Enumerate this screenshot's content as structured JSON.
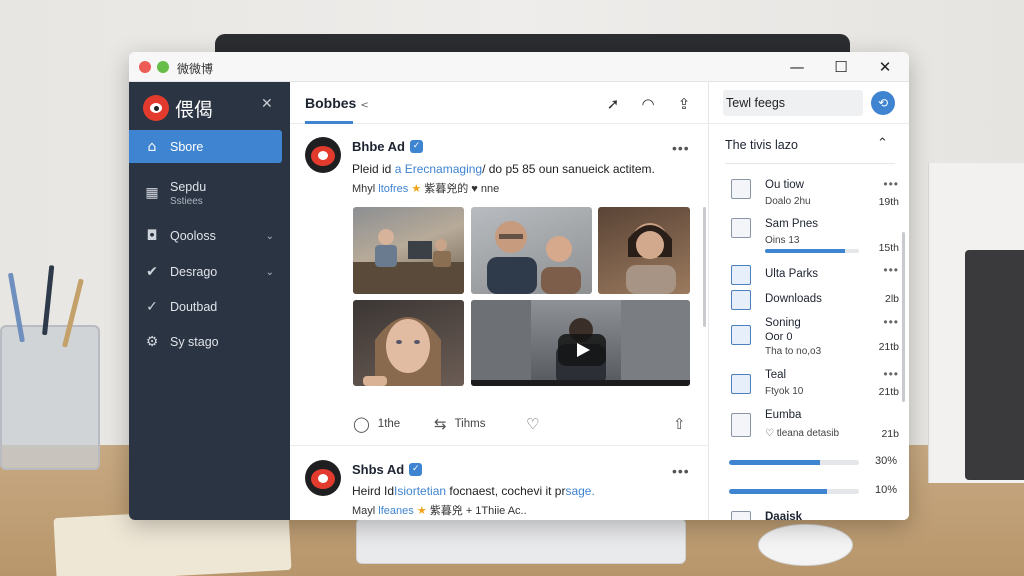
{
  "window": {
    "title": "微微博",
    "controls": {
      "minimize": "—",
      "maximize": "☐",
      "close": "✕"
    },
    "dot_colors": [
      "#ee5d55",
      "#66bd48"
    ]
  },
  "sidebar": {
    "brand": "偎偈",
    "close_glyph": "✕",
    "items": [
      {
        "label": "Sbore",
        "sub": "",
        "icon": "home-icon",
        "glyph": "⌂",
        "active": true,
        "chevron": ""
      },
      {
        "label": "Sepdu",
        "sub": "Sstiees",
        "icon": "grid-icon",
        "glyph": "▦",
        "active": false,
        "chevron": ""
      },
      {
        "label": "Qooloss",
        "sub": "",
        "icon": "square-icon",
        "glyph": "◘",
        "active": false,
        "chevron": "⌄"
      },
      {
        "label": "Desrago",
        "sub": "",
        "icon": "check-circle-icon",
        "glyph": "✔",
        "active": false,
        "chevron": "⌄"
      },
      {
        "label": "Doutbad",
        "sub": "",
        "icon": "check-outline-icon",
        "glyph": "✓",
        "active": false,
        "chevron": ""
      },
      {
        "label": "Sy stago",
        "sub": "",
        "icon": "gear-icon",
        "glyph": "⚙",
        "active": false,
        "chevron": ""
      }
    ]
  },
  "feed": {
    "title": "Bobbes",
    "title_caret": "<",
    "header_icons": [
      {
        "name": "send-icon",
        "glyph": "➚"
      },
      {
        "name": "bell-icon",
        "glyph": "◠"
      },
      {
        "name": "share-icon",
        "glyph": "⇪"
      }
    ],
    "posts": [
      {
        "author": "Bhbe Ad",
        "verified_glyph": "✓",
        "more": "•••",
        "text_a": "Pleid id ",
        "text_link": "a Erecnamaging",
        "text_b": "/ do p5 85 oun sanueick actitem.",
        "meta_a": "Mhyl ",
        "meta_link": "ltofres",
        "meta_star": "★",
        "meta_b": " 紫暮兇的 ♥ nne",
        "actions": [
          {
            "icon": "comment-icon",
            "glyph": "◯",
            "label": "1the"
          },
          {
            "icon": "repost-icon",
            "glyph": "⇆",
            "label": "Tihms"
          },
          {
            "icon": "heart-icon",
            "glyph": "♡",
            "label": ""
          },
          {
            "icon": "upload-icon",
            "glyph": "⇧",
            "label": ""
          }
        ]
      },
      {
        "author": "Shbs Ad",
        "verified_glyph": "✓",
        "more": "•••",
        "text_a": "Heird Id",
        "text_link": "Isiortetian",
        "text_b": " focnaest, cochevi it pr",
        "text_link2": "sage.",
        "meta_a": "Mayl ",
        "meta_link": "lfeanes",
        "meta_star": "★",
        "meta_b": " 紫暮兇 + 1Thiie Ac.."
      }
    ]
  },
  "right_panel": {
    "search_value": "Tewl feegs",
    "search_glyph": "⟲",
    "panel_title": "The tivis lazo",
    "panel_toggle": "⌃",
    "files": [
      {
        "name": "Ou tiow",
        "sub": "Doalo 2hu",
        "side": "19th",
        "more": "•••",
        "folder": false
      },
      {
        "name": "Sam Pnes",
        "sub": "Oins 13",
        "side": "15th",
        "more": "",
        "progress": 0.85,
        "folder": false
      },
      {
        "name": "Ulta Parks",
        "sub": "",
        "side": "",
        "more": "•••",
        "folder": true
      },
      {
        "name": "Downloads",
        "sub": "",
        "side": "2lb",
        "more": "",
        "folder": true
      },
      {
        "name": "Soning",
        "sub": "Oor 0",
        "sub2": "Tha to no,o3",
        "side": "21tb",
        "more": "•••",
        "folder": true
      },
      {
        "name": "Teal",
        "sub": "Ftyok 10",
        "side": "21tb",
        "more": "•••",
        "folder": true
      },
      {
        "name": "Eumba",
        "sub": "♡ tleana detasib",
        "side": "21b",
        "more": "",
        "folder": false
      }
    ],
    "progress": [
      {
        "value": 0.7,
        "label": "30%"
      },
      {
        "value": 0.75,
        "label": "10%"
      }
    ],
    "last_item": "Daaisk"
  },
  "colors": {
    "accent": "#3f84d0",
    "sidebar": "#2b3442",
    "brand_red": "#e23b2e"
  }
}
